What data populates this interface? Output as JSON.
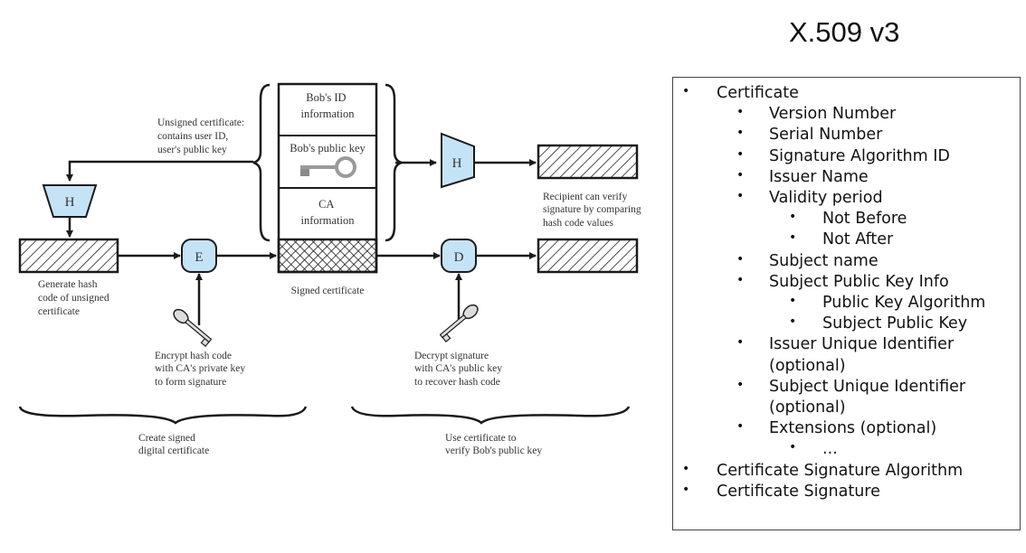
{
  "title": "X.509 v3",
  "diagram": {
    "unsigned_note": [
      "Unsigned certificate:",
      "contains user ID,",
      "user's public key"
    ],
    "hash_label": "H",
    "encrypt_label": "E",
    "decrypt_label": "D",
    "cert_fields": {
      "id": [
        "Bob's ID",
        "information"
      ],
      "pubkey": "Bob's public key",
      "ca": [
        "CA",
        "information"
      ]
    },
    "signed_cert_label": "Signed certificate",
    "generate_hash_note": [
      "Generate hash",
      "code of unsigned",
      "certificate"
    ],
    "encrypt_note": [
      "Encrypt hash code",
      "with CA's private key",
      "to form signature"
    ],
    "decrypt_note": [
      "Decrypt signature",
      "with CA's public key",
      "to recover hash code"
    ],
    "recipient_note": [
      "Recipient can verify",
      "signature by comparing",
      "hash code values"
    ],
    "create_group": [
      "Create signed",
      "digital certificate"
    ],
    "use_group": [
      "Use certificate to",
      "verify Bob's public key"
    ],
    "colors": {
      "box_fill": "#c5e3f6",
      "stroke": "#1a1a1a"
    }
  },
  "fields_list": [
    {
      "level": 0,
      "text": "Certificate"
    },
    {
      "level": 1,
      "text": "Version Number"
    },
    {
      "level": 1,
      "text": "Serial Number"
    },
    {
      "level": 1,
      "text": "Signature Algorithm ID"
    },
    {
      "level": 1,
      "text": "Issuer Name"
    },
    {
      "level": 1,
      "text": "Validity period"
    },
    {
      "level": 2,
      "text": "Not Before"
    },
    {
      "level": 2,
      "text": "Not After"
    },
    {
      "level": 1,
      "text": "Subject name"
    },
    {
      "level": 1,
      "text": "Subject Public Key Info"
    },
    {
      "level": 2,
      "text": "Public Key Algorithm"
    },
    {
      "level": 2,
      "text": "Subject Public Key"
    },
    {
      "level": 1,
      "text": "Issuer Unique Identifier"
    },
    {
      "level": 1,
      "text": "(optional)",
      "continuation": true
    },
    {
      "level": 1,
      "text": "Subject Unique Identifier"
    },
    {
      "level": 1,
      "text": "(optional)",
      "continuation": true
    },
    {
      "level": 1,
      "text": "Extensions (optional)"
    },
    {
      "level": 2,
      "text": "..."
    },
    {
      "level": 0,
      "text": "Certificate Signature Algorithm"
    },
    {
      "level": 0,
      "text": "Certificate Signature"
    }
  ]
}
